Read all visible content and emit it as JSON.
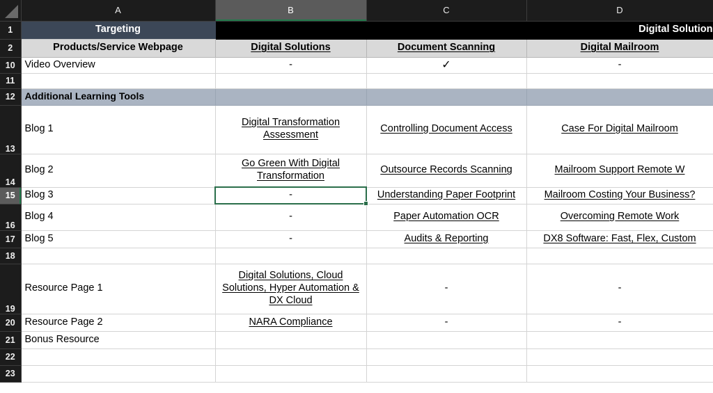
{
  "app": {
    "type": "spreadsheet",
    "selected_cell": "B15",
    "active_column": "B",
    "active_row": "15"
  },
  "colors": {
    "header_bar": "#1c1c1c",
    "header_active": "#5b5b5b",
    "selection": "#2a6e4a",
    "title_row_fill": "#3c4757",
    "title_row_black": "#000000",
    "subheader_fill": "#d9d9d9",
    "section_band": "#aab4c2",
    "gridline": "#d4d4d4"
  },
  "columns": [
    {
      "id": "rowhdr",
      "label": "",
      "active": false
    },
    {
      "id": "A",
      "label": "A",
      "active": false
    },
    {
      "id": "B",
      "label": "B",
      "active": true
    },
    {
      "id": "C",
      "label": "C",
      "active": false
    },
    {
      "id": "D",
      "label": "D",
      "active": false
    }
  ],
  "rows": [
    {
      "num": "1",
      "style": "title",
      "a": "Targeting",
      "merged_bcd": "Digital Solution"
    },
    {
      "num": "2",
      "style": "subheader",
      "a": "Products/Service Webpage",
      "b": "Digital Solutions",
      "c": "Document Scanning",
      "d": "Digital Mailroom"
    },
    {
      "num": "10",
      "style": "data",
      "a": "Video Overview",
      "b": "-",
      "c": "✓",
      "d": "-"
    },
    {
      "num": "11",
      "style": "empty",
      "a": "",
      "b": "",
      "c": "",
      "d": ""
    },
    {
      "num": "12",
      "style": "band",
      "a": "Additional Learning Tools",
      "b": "",
      "c": "",
      "d": ""
    },
    {
      "num": "13",
      "style": "tall",
      "a": "Blog 1",
      "b": "Digital Transformation Assessment",
      "c": "Controlling Document Access",
      "d": "Case For Digital Mailroom",
      "b_link": true,
      "c_link": true,
      "d_link": true
    },
    {
      "num": "14",
      "style": "tall2",
      "a": "Blog 2",
      "b": "Go Green With Digital Transformation",
      "c": "Outsource Records Scanning",
      "d": "Mailroom Support Remote W",
      "b_link": true,
      "c_link": true,
      "d_link": true
    },
    {
      "num": "15",
      "style": "data",
      "a": "Blog 3",
      "b": "-",
      "c": "Understanding Paper Footprint",
      "d": "Mailroom Costing Your Business?",
      "c_link": true,
      "d_link": true
    },
    {
      "num": "16",
      "style": "tall3",
      "a": "Blog 4",
      "b": "-",
      "c": "Paper Automation OCR",
      "d": "Overcoming Remote Work",
      "c_link": true,
      "d_link": true
    },
    {
      "num": "17",
      "style": "data",
      "a": "Blog 5",
      "b": "-",
      "c": "Audits & Reporting",
      "d": "DX8 Software: Fast, Flex, Custom",
      "c_link": true,
      "d_link": true
    },
    {
      "num": "18",
      "style": "empty",
      "a": "",
      "b": "",
      "c": "",
      "d": ""
    },
    {
      "num": "19",
      "style": "tallest",
      "a": "Resource Page 1",
      "b": "Digital Solutions, Cloud Solutions, Hyper Automation & DX Cloud",
      "c": "-",
      "d": "-",
      "b_link": true
    },
    {
      "num": "20",
      "style": "data",
      "a": "Resource Page 2",
      "b": "NARA Compliance",
      "c": "-",
      "d": "-",
      "b_link": true
    },
    {
      "num": "21",
      "style": "data",
      "a": "Bonus Resource",
      "b": "",
      "c": "",
      "d": ""
    },
    {
      "num": "22",
      "style": "empty",
      "a": "",
      "b": "",
      "c": "",
      "d": ""
    },
    {
      "num": "23",
      "style": "cutoff",
      "a": "",
      "b": "",
      "c": "",
      "d": ""
    }
  ]
}
